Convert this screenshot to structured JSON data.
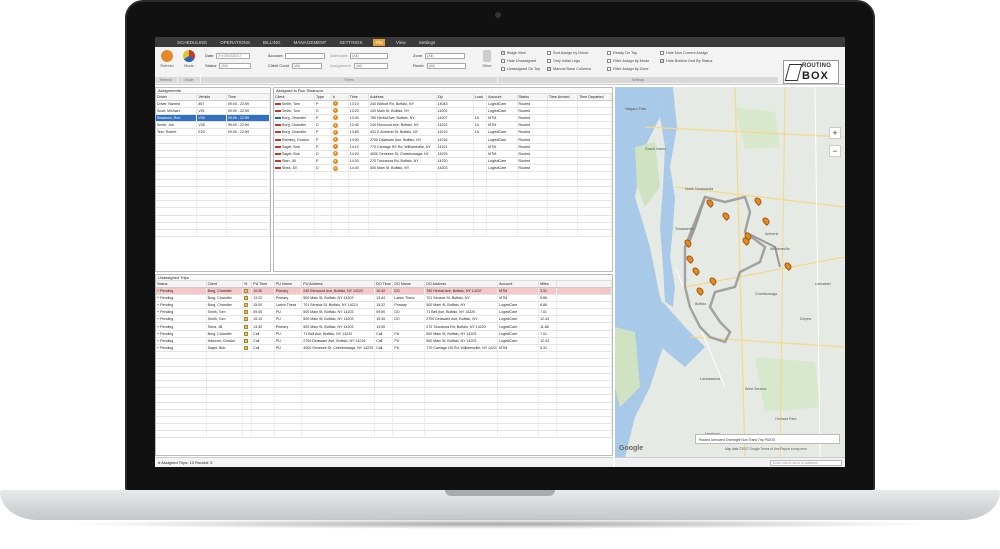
{
  "menu": {
    "items": [
      "SCHEDULING",
      "OPERATIONS",
      "BILLING",
      "MANAGEMENT",
      "SETTINGS",
      "File",
      "View",
      "Settings"
    ],
    "active_index": 5
  },
  "toolbar": {
    "refresh_label": "Refresh",
    "mode_label": "Mode",
    "other_label": "Other",
    "date_label": "Date",
    "date_value": "Fri 09/15/2017",
    "status_label": "Status",
    "status_value": "(All)",
    "account_label": "Account",
    "account_value": "",
    "client_cond_label": "Client Cond",
    "client_cond_value": "(All)",
    "attendant_label": "Attendant",
    "attendant_value": "(All)",
    "assignment_label": "Assignment",
    "assignment_value": "(All)",
    "zone_label": "Zone",
    "zone_value": "(All)",
    "route_label": "Route",
    "route_value": "(All)",
    "filters_group_label": "Filters",
    "settings_group_label": "Settings",
    "checkboxes": [
      {
        "label": "Bidge View",
        "checked": true
      },
      {
        "label": "Hide Unassigned",
        "checked": false
      },
      {
        "label": "Unassigned On Top",
        "checked": false
      },
      {
        "label": "Sort Assign by Driver",
        "checked": false
      },
      {
        "label": "Only Initial Legs",
        "checked": false
      },
      {
        "label": "Manual Base Columns",
        "checked": true
      },
      {
        "label": "Ready On Top",
        "checked": false
      },
      {
        "label": "Filter Assign by Mode",
        "checked": false
      },
      {
        "label": "Filter Assign by Zone",
        "checked": false
      },
      {
        "label": "Hide Non Current Assign",
        "checked": false
      },
      {
        "label": "Hide Bottom Grid By Status",
        "checked": true
      }
    ]
  },
  "logo": {
    "top": "ROUTING",
    "bottom": "BOX"
  },
  "assignments": {
    "title": "Assignments",
    "columns": [
      "Driver",
      "Vehicle",
      "Time"
    ],
    "rows": [
      [
        "Driver, Named",
        "857",
        "09:00 - 22:59"
      ],
      [
        "Scott, Michael",
        "V01",
        "09:00 - 22:59"
      ],
      [
        "Swanson, Ron",
        "V30",
        "09:00 - 22:59"
      ],
      [
        "Smith, Joe",
        "V35",
        "09:00 - 22:59"
      ],
      [
        "Test, Robert",
        "E20",
        "09:00 - 22:59"
      ]
    ],
    "selected_index": 2
  },
  "assigned": {
    "title": "Assigned to Ron Swanson",
    "columns": [
      "Client",
      "Type",
      "#",
      "Time",
      "Address",
      "Zip",
      "Load",
      "Account",
      "Status",
      "Time Arrived",
      "Time Departed"
    ],
    "rows": [
      {
        "client": "Smith, Tom",
        "type": "P",
        "num": "1",
        "time": "13:10",
        "address": "240 Elbbott Rd, Buffalo, NY",
        "zip": "14043",
        "load": "",
        "account": "LogistiCare",
        "status": "Routed",
        "flag": "red"
      },
      {
        "client": "Smith, Tom",
        "type": "D",
        "num": "2",
        "time": "13:20",
        "address": "100 Main St, Buffalo, NY",
        "zip": "14202",
        "load": "",
        "account": "LogistiCare",
        "status": "Routed",
        "flag": "red"
      },
      {
        "client": "Borg, Chandler",
        "type": "P",
        "num": "3",
        "time": "13:30",
        "address": "780 Herbal Ave, Buffalo, NY",
        "zip": "14207",
        "load": "1A",
        "account": "MTM",
        "status": "Routed",
        "flag": "blue"
      },
      {
        "client": "Borg, Chandler",
        "type": "D",
        "num": "4",
        "time": "13:40",
        "address": "240 Elmwood Ave, Buffalo, NY",
        "zip": "14222",
        "load": "1A",
        "account": "MTM",
        "status": "Routed",
        "flag": "red"
      },
      {
        "client": "Borg, Chandler",
        "type": "P",
        "num": "5",
        "time": "13:50",
        "address": "431 E Amherst St, Buffalo, NY",
        "zip": "14215",
        "load": "1A",
        "account": "LogistiCare",
        "status": "Routed",
        "flag": "red"
      },
      {
        "client": "Ramsey, Gordon",
        "type": "P",
        "num": "6",
        "time": "14:00",
        "address": "2700 Delaware Ave, Buffalo, NY",
        "zip": "14216",
        "load": "",
        "account": "LogistiCare",
        "status": "Routed",
        "flag": "red"
      },
      {
        "client": "Saget, Bob",
        "type": "P",
        "num": "7",
        "time": "14:10",
        "address": "770 Carriage HS Rd, Williamsville, NY",
        "zip": "14221",
        "load": "",
        "account": "MTM",
        "status": "Routed",
        "flag": "red"
      },
      {
        "client": "Saget, Bob",
        "type": "D",
        "num": "8",
        "time": "14:20",
        "address": "4000 Genesee St, Cheektowaga, NY",
        "zip": "14225",
        "load": "",
        "account": "MTM",
        "status": "Routed",
        "flag": "red"
      },
      {
        "client": "Starr, Jill",
        "type": "P",
        "num": "9",
        "time": "14:30",
        "address": "270 Tuscarora Rd, Buffalo, NY",
        "zip": "14220",
        "load": "",
        "account": "LogistiCare",
        "status": "Routed",
        "flag": "red"
      },
      {
        "client": "Shea, Jill",
        "type": "D",
        "num": "10",
        "time": "14:40",
        "address": "500 Main St, Buffalo, NY",
        "zip": "14203",
        "load": "",
        "account": "LogistiCare",
        "status": "Routed",
        "flag": "red"
      }
    ]
  },
  "unassigned": {
    "title": "Unassigned Trips",
    "columns": [
      "Status",
      "Client",
      "%",
      "PU Time",
      "PU Name",
      "PU Address",
      "DO Time",
      "DO Name",
      "DO Address",
      "Account",
      "Miles"
    ],
    "rows": [
      {
        "status": "Pending",
        "client": "Borg, Chandler",
        "pu_time": "10:30",
        "pu_name": "Primary",
        "pu_address": "240 Elmwood Ave, Buffalo, NY 14222",
        "do_time": "10:42",
        "do_name": "DO",
        "do_address": "780 Herbal Ave, Buffalo, NY 14207",
        "account": "MTM",
        "miles": "3.31",
        "hl": true
      },
      {
        "status": "Pending",
        "client": "Borg, Chandler",
        "pu_time": "13:22",
        "pu_name": "Primary",
        "pu_address": "500 Main St, Buffalo, NY 14203",
        "do_time": "13:44",
        "do_name": "Larkin Thera",
        "do_address": "701 Seneca St, Buffalo, NY",
        "account": "MTM",
        "miles": "6.86",
        "hl": false
      },
      {
        "status": "Pending",
        "client": "Borg, Chandler",
        "pu_time": "15:00",
        "pu_name": "Larkin Thera",
        "pu_address": "701 Seneca St, Buffalo, NY 14210",
        "do_time": "15:22",
        "do_name": "Primary",
        "do_address": "500 Main St, Buffalo, NY",
        "account": "LogistiCare",
        "miles": "6.86",
        "hl": false
      },
      {
        "status": "Pending",
        "client": "Smith, Tom",
        "pu_time": "09:30",
        "pu_name": "PU",
        "pu_address": "500 Main St, Buffalo, NY 14203",
        "do_time": "09:50",
        "do_name": "DO",
        "do_address": "71 Bell Ave, Buffalo, NY 14220",
        "account": "LogistiCare",
        "miles": "7.01",
        "hl": false
      },
      {
        "status": "Pending",
        "client": "Smith, Tom",
        "pu_time": "15:10",
        "pu_name": "PU",
        "pu_address": "500 Main St, Buffalo, NY 14203",
        "do_time": "15:30",
        "do_name": "DO",
        "do_address": "2700 Delaware Ave, Buffalo, NY",
        "account": "LogistiCare",
        "miles": "12.43",
        "hl": false
      },
      {
        "status": "Pending",
        "client": "Shea, Jill",
        "pu_time": "13:30",
        "pu_name": "Primary",
        "pu_address": "500 Main St, Buffalo, NY 14203",
        "do_time": "13:50",
        "do_name": "",
        "do_address": "270 Tuscarora Rd, Buffalo, NY 14220",
        "account": "LogistiCare",
        "miles": "11.86",
        "hl": false
      },
      {
        "status": "Pending",
        "client": "Borg, Chandler",
        "pu_time": "Call",
        "pu_name": "PU",
        "pu_address": "71 Bell Ave, Buffalo, NY 14220",
        "do_time": "Call",
        "do_name": "PU",
        "do_address": "500 Main St, Buffalo, NY 14203",
        "account": "LogistiCare",
        "miles": "7.01",
        "hl": false
      },
      {
        "status": "Pending",
        "client": "Hanover, Gordon",
        "pu_time": "Call",
        "pu_name": "PU",
        "pu_address": "2700 Delaware Ave, Buffalo, NY 14216",
        "do_time": "Call",
        "do_name": "PU",
        "do_address": "500 Main St, Buffalo, NY 14203",
        "account": "LogistiCare",
        "miles": "12.43",
        "hl": false
      },
      {
        "status": "Pending",
        "client": "Saget, Bob",
        "pu_time": "Call",
        "pu_name": "PU",
        "pu_address": "4000 Genesee St, Cheektowaga, NY 14225",
        "do_time": "Call",
        "do_name": "PU",
        "do_address": "770 Carriage HS Rd, Williamsville, NY 14221",
        "account": "MTM",
        "miles": "5.31",
        "hl": false
      }
    ]
  },
  "statusbar": {
    "text": "# Assigned Trips: 10    Routed: 5"
  },
  "map": {
    "zoom_in": "+",
    "zoom_out": "−",
    "legend": "Routed  Unrouted  Overnight  Non Trans  Trip PU/DO",
    "google": "Google",
    "attribution": "Map data ©2017 Google   Terms of Use   Report a map error",
    "search_placeholder": "Enter client name or address",
    "labels": [
      "Tonawanda",
      "North Tonawanda",
      "Amherst",
      "Williamsville",
      "Cheektowaga",
      "Buffalo",
      "Lackawanna",
      "West Seneca",
      "Depew",
      "Lancaster",
      "Orchard Park",
      "Hamburg",
      "Grand Island",
      "Niagara Falls"
    ]
  }
}
